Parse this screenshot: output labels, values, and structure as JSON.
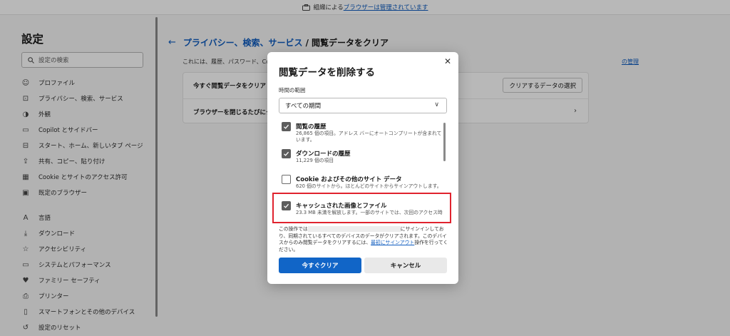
{
  "banner": {
    "prefix": "組織による",
    "link": "ブラウザーは管理されています"
  },
  "sidebar": {
    "title": "設定",
    "search_placeholder": "設定の検索",
    "items": [
      {
        "label": "プロファイル",
        "icon": "profile-icon"
      },
      {
        "label": "プライバシー、検索、サービス",
        "icon": "lock-icon"
      },
      {
        "label": "外観",
        "icon": "appearance-icon"
      },
      {
        "label": "Copilot とサイドバー",
        "icon": "sidebar-icon"
      },
      {
        "label": "スタート、ホーム、新しいタブ ページ",
        "icon": "home-icon"
      },
      {
        "label": "共有、コピー、貼り付け",
        "icon": "share-icon"
      },
      {
        "label": "Cookie とサイトのアクセス許可",
        "icon": "cookie-icon"
      },
      {
        "label": "既定のブラウザー",
        "icon": "browser-icon"
      },
      {
        "label": "言語",
        "icon": "language-icon"
      },
      {
        "label": "ダウンロード",
        "icon": "download-icon"
      },
      {
        "label": "アクセシビリティ",
        "icon": "accessibility-icon"
      },
      {
        "label": "システムとパフォーマンス",
        "icon": "system-icon"
      },
      {
        "label": "ファミリー セーフティ",
        "icon": "family-icon"
      },
      {
        "label": "プリンター",
        "icon": "printer-icon"
      },
      {
        "label": "スマートフォンとその他のデバイス",
        "icon": "phone-icon"
      },
      {
        "label": "設定のリセット",
        "icon": "reset-icon"
      }
    ]
  },
  "main": {
    "crumb_link": "プライバシー、検索、サービス",
    "crumb_sep": "/",
    "crumb_current": "閲覧データをクリア",
    "desc": "これには、履歴、パスワード、Coc",
    "desc_link": "の管理",
    "row1_label": "今すぐ閲覧データをクリア",
    "row1_button": "クリアするデータの選択",
    "row2_label": "ブラウザーを閉じるたびにクリア"
  },
  "dialog": {
    "title": "閲覧データを削除する",
    "time_range_label": "時間の範囲",
    "time_range_value": "すべての期間",
    "options": [
      {
        "title": "閲覧の履歴",
        "sub": "26,865 個の項目。アドレス バーにオートコンプリートが含まれています。",
        "checked": true
      },
      {
        "title": "ダウンロードの履歴",
        "sub": "11,229 個の項目",
        "checked": true
      },
      {
        "title": "Cookie およびその他のサイト データ",
        "sub": "620 個のサイトから。ほとんどのサイトからサインアウトします。",
        "checked": false
      },
      {
        "title": "キャッシュされた画像とファイル",
        "sub": "23.3 MB 未満を解放します。一部のサイトでは、次回のアクセス時",
        "checked": true
      }
    ],
    "info_prefix": "この操作では",
    "info_mid": "にサインインしており、同期されているすべてのデバイスのデータがクリアされます。このデバイスからのみ閲覧データをクリアするには、",
    "info_link": "最初にサインアウト",
    "info_suffix": "操作を行ってください。",
    "primary_button": "今すぐクリア",
    "cancel_button": "キャンセル"
  },
  "colors": {
    "accent": "#1165c7",
    "link": "#0f5cbf",
    "highlight": "#e0232e"
  }
}
